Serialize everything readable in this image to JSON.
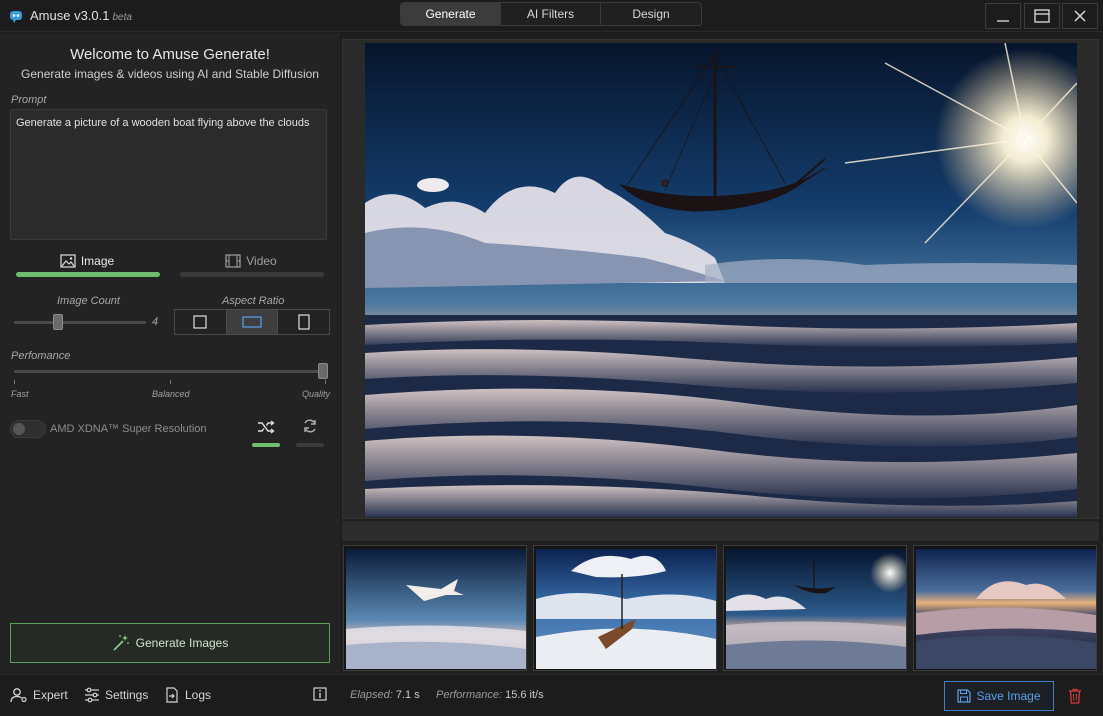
{
  "app": {
    "title": "Amuse v3.0.1",
    "badge": "beta"
  },
  "tabs": [
    {
      "label": "Generate",
      "active": true
    },
    {
      "label": "AI Filters",
      "active": false
    },
    {
      "label": "Design",
      "active": false
    }
  ],
  "window_controls": {
    "minimize_icon": "minimize-icon",
    "maximize_icon": "maximize-icon",
    "close_icon": "close-icon"
  },
  "welcome": {
    "title": "Welcome to Amuse Generate!",
    "subtitle": "Generate images & videos using AI and Stable Diffusion"
  },
  "prompt": {
    "label": "Prompt",
    "value": "Generate a picture of a wooden boat flying above the clouds"
  },
  "mode": {
    "image_label": "Image",
    "video_label": "Video",
    "selected": "Image"
  },
  "image_count": {
    "label": "Image Count",
    "value": "4"
  },
  "aspect_ratio": {
    "label": "Aspect Ratio",
    "options": [
      "square",
      "landscape",
      "portrait"
    ],
    "selected": "landscape"
  },
  "performance": {
    "label": "Perfomance",
    "ticks": [
      "Fast",
      "Balanced",
      "Quality"
    ],
    "level": 1.0
  },
  "super_resolution": {
    "label": "AMD XDNA™ Super Resolution",
    "enabled": false
  },
  "seed_controls": {
    "random_active": true,
    "repeat_active": false
  },
  "generate_button": {
    "label": "Generate Images"
  },
  "bottom": {
    "expert_label": "Expert",
    "settings_label": "Settings",
    "logs_label": "Logs",
    "elapsed_label": "Elapsed:",
    "elapsed_value": "7.1 s",
    "performance_label": "Performance:",
    "performance_value": "15.6 it/s",
    "save_label": "Save Image"
  },
  "colors": {
    "accent_green": "#6fbf6f",
    "accent_blue": "#3d7fc7",
    "delete_red": "#d33a3a"
  }
}
